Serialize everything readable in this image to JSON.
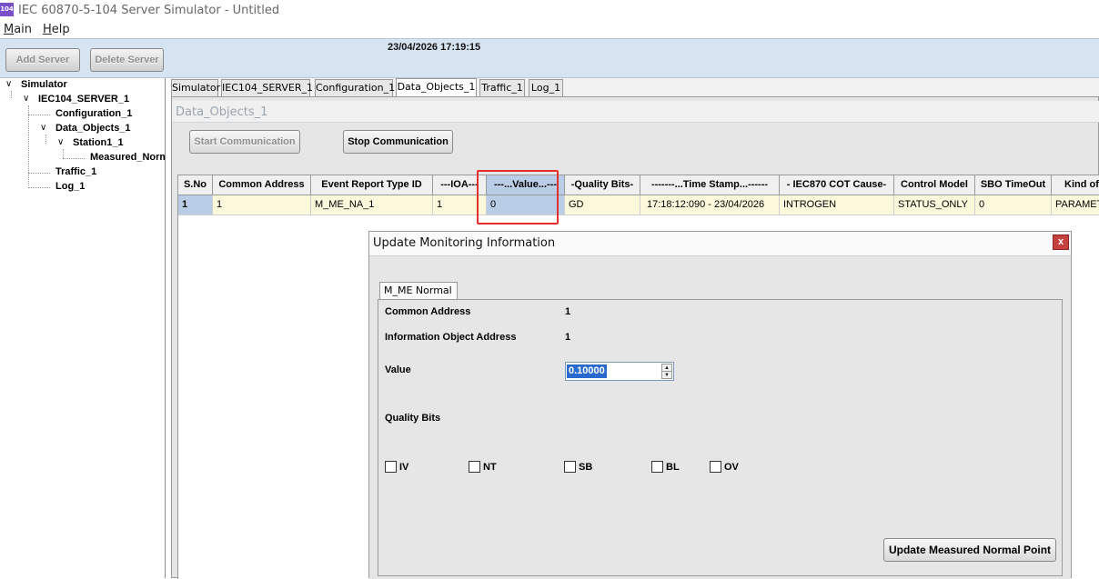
{
  "window": {
    "title": "IEC 60870-5-104 Server Simulator - Untitled",
    "icon_text": "104"
  },
  "menu": {
    "items": [
      "Main",
      "Help"
    ]
  },
  "toolbar": {
    "add_server": "Add Server",
    "delete_server": "Delete Server",
    "datetime": "23/04/2026 17:19:15"
  },
  "tree": {
    "root": "Simulator",
    "server": "IEC104_SERVER_1",
    "configuration": "Configuration_1",
    "data_objects": "Data_Objects_1",
    "station": "Station1_1",
    "measured": "Measured_Normal",
    "traffic": "Traffic_1",
    "log": "Log_1"
  },
  "tabs": [
    "Simulator",
    "IEC104_SERVER_1",
    "Configuration_1",
    "Data_Objects_1",
    "Traffic_1",
    "Log_1"
  ],
  "active_tab": "Data_Objects_1",
  "panel": {
    "title": "Data_Objects_1",
    "start_label": "Start Communication",
    "stop_label": "Stop Communication"
  },
  "grid": {
    "headers": [
      "S.No",
      "Common Address",
      "Event Report Type ID",
      "---IOA---",
      "---...Value...---",
      "-Quality Bits-",
      "-------...Time Stamp...------",
      "-  IEC870 COT Cause-",
      "Control Model",
      "SBO TimeOut",
      "Kind of"
    ],
    "rows": [
      [
        "1",
        "1",
        "M_ME_NA_1",
        "1",
        "0",
        "GD",
        "17:18:12:090 - 23/04/2026",
        "INTROGEN",
        "STATUS_ONLY",
        "0",
        "PARAMETER"
      ]
    ]
  },
  "dialog": {
    "title": "Update Monitoring Information",
    "tab": "M_ME Normal",
    "common_address_label": "Common Address",
    "common_address_value": "1",
    "ioa_label": "Information Object Address",
    "ioa_value": "1",
    "value_label": "Value",
    "value": "0.10000",
    "quality_label": "Quality Bits",
    "quality_bits": [
      "IV",
      "NT",
      "SB",
      "BL",
      "OV"
    ],
    "update_button": "Update Measured Normal Point"
  },
  "colors": {
    "toolbar_bg": "#d6e4f1",
    "row_bg": "#fcf8dc",
    "selection": "#b9cde6",
    "highlight": "#e52f2f",
    "close_button": "#c4413f"
  }
}
